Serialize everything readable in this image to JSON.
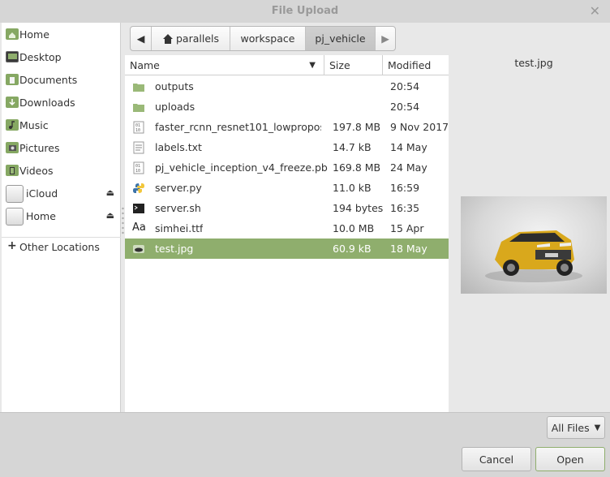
{
  "window": {
    "title": "File Upload"
  },
  "sidebar": {
    "items": [
      {
        "label": "Home",
        "icon": "home-folder-icon"
      },
      {
        "label": "Desktop",
        "icon": "desktop-icon"
      },
      {
        "label": "Documents",
        "icon": "documents-folder-icon"
      },
      {
        "label": "Downloads",
        "icon": "downloads-folder-icon"
      },
      {
        "label": "Music",
        "icon": "music-folder-icon"
      },
      {
        "label": "Pictures",
        "icon": "pictures-folder-icon"
      },
      {
        "label": "Videos",
        "icon": "videos-folder-icon"
      },
      {
        "label": "iCloud",
        "icon": "drive-icon"
      },
      {
        "label": "Home",
        "icon": "drive-icon"
      }
    ],
    "other_locations": "Other Locations"
  },
  "pathbar": {
    "segments": [
      "parallels",
      "workspace",
      "pj_vehicle"
    ],
    "active": "pj_vehicle"
  },
  "filelist": {
    "columns": [
      "Name",
      "Size",
      "Modified"
    ],
    "rows": [
      {
        "name": "outputs",
        "size": "",
        "modified": "20:54",
        "icon": "folder-icon"
      },
      {
        "name": "uploads",
        "size": "",
        "modified": "20:54",
        "icon": "folder-icon"
      },
      {
        "name": "faster_rcnn_resnet101_lowpropos…",
        "size": "197.8 MB",
        "modified": "9 Nov 2017",
        "icon": "binary-file-icon"
      },
      {
        "name": "labels.txt",
        "size": "14.7 kB",
        "modified": "14 May",
        "icon": "text-file-icon"
      },
      {
        "name": "pj_vehicle_inception_v4_freeze.pb",
        "size": "169.8 MB",
        "modified": "24 May",
        "icon": "binary-file-icon"
      },
      {
        "name": "server.py",
        "size": "11.0 kB",
        "modified": "16:59",
        "icon": "python-file-icon"
      },
      {
        "name": "server.sh",
        "size": "194 bytes",
        "modified": "16:35",
        "icon": "terminal-script-icon"
      },
      {
        "name": "simhei.ttf",
        "size": "10.0 MB",
        "modified": "15 Apr",
        "icon": "font-file-icon"
      },
      {
        "name": "test.jpg",
        "size": "60.9 kB",
        "modified": "18 May",
        "icon": "image-file-icon",
        "selected": true
      }
    ]
  },
  "preview": {
    "label": "test.jpg"
  },
  "filter": {
    "label": "All Files"
  },
  "buttons": {
    "cancel": "Cancel",
    "open": "Open"
  },
  "colors": {
    "selection": "#8fae6d",
    "folder": "#9ab978"
  }
}
